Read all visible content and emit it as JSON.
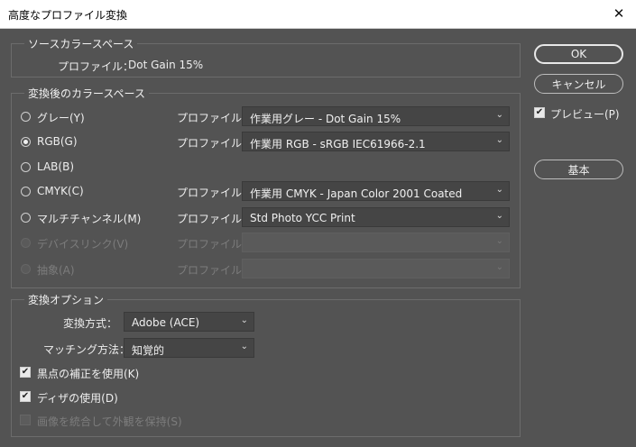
{
  "window": {
    "title": "高度なプロファイル変換",
    "close_glyph": "✕"
  },
  "source": {
    "legend": "ソースカラースペース",
    "profile_label": "プロファイル：",
    "profile_value": "Dot Gain 15%"
  },
  "dest": {
    "legend": "変換後のカラースペース",
    "profile_label": "プロファイル：",
    "rows": [
      {
        "label": "グレー(Y)",
        "profile": "作業用グレー - Dot Gain 15%",
        "selected": false,
        "enabled": true
      },
      {
        "label": "RGB(G)",
        "profile": "作業用 RGB - sRGB IEC61966-2.1",
        "selected": true,
        "enabled": true
      },
      {
        "label": "LAB(B)",
        "profile": "",
        "selected": false,
        "enabled": true
      },
      {
        "label": "CMYK(C)",
        "profile": "作業用 CMYK - Japan Color 2001 Coated",
        "selected": false,
        "enabled": true
      },
      {
        "label": "マルチチャンネル(M)",
        "profile": "Std Photo YCC Print",
        "selected": false,
        "enabled": true
      },
      {
        "label": "デバイスリンク(V)",
        "profile": "",
        "selected": false,
        "enabled": false
      },
      {
        "label": "抽象(A)",
        "profile": "",
        "selected": false,
        "enabled": false
      }
    ]
  },
  "options": {
    "legend": "変換オプション",
    "engine_label": "変換方式：",
    "engine_value": "Adobe (ACE)",
    "intent_label": "マッチング方法：",
    "intent_value": "知覚的",
    "bpc_label": "黒点の補正を使用(K)",
    "bpc_checked": true,
    "dither_label": "ディザの使用(D)",
    "dither_checked": true,
    "flatten_label": "画像を統合して外観を保持(S)",
    "flatten_checked": false
  },
  "buttons": {
    "ok": "OK",
    "cancel": "キャンセル",
    "basic": "基本"
  },
  "preview": {
    "label": "プレビュー(P)",
    "checked": true
  },
  "icons": {
    "chevron": "chevron-down-icon",
    "check": "checkmark-icon"
  },
  "glyphs": {
    "chevron": "⌄",
    "check": "✔"
  }
}
